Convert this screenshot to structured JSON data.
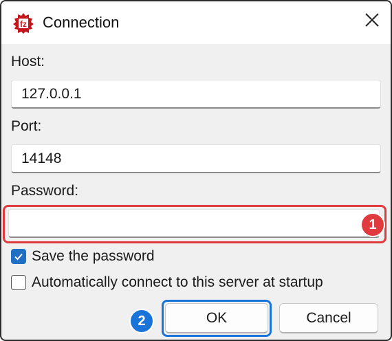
{
  "window": {
    "title": "Connection",
    "app_icon": "filezilla-icon",
    "close_icon": "close-icon"
  },
  "form": {
    "host_label": "Host:",
    "host_value": "127.0.0.1",
    "port_label": "Port:",
    "port_value": "14148",
    "password_label": "Password:",
    "password_value": ""
  },
  "checkboxes": {
    "save_password_label": "Save the password",
    "save_password_checked": true,
    "auto_connect_label": "Automatically connect to this server at startup",
    "auto_connect_checked": false
  },
  "buttons": {
    "ok_label": "OK",
    "cancel_label": "Cancel"
  },
  "annotations": {
    "step1": "1",
    "step2": "2",
    "step1_color": "#e0393e",
    "step2_color": "#1a73d9"
  }
}
